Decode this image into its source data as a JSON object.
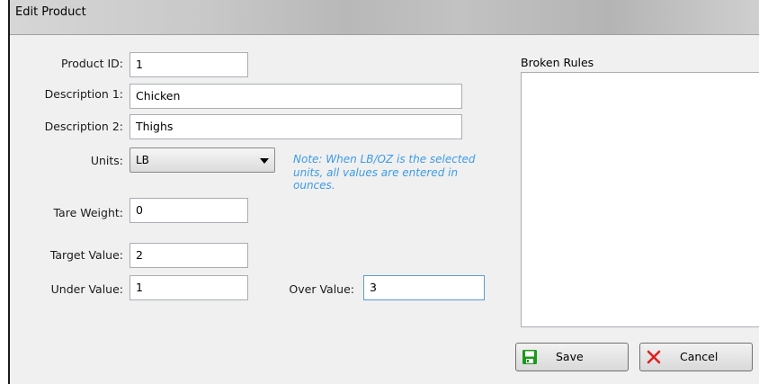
{
  "window": {
    "title": "Edit Product"
  },
  "form": {
    "product_id": {
      "label": "Product ID:",
      "value": "1"
    },
    "description1": {
      "label": "Description 1:",
      "value": "Chicken"
    },
    "description2": {
      "label": "Description 2:",
      "value": "Thighs"
    },
    "units": {
      "label": "Units:",
      "selected": "LB"
    },
    "note": "Note: When LB/OZ is the selected units, all values are entered in ounces.",
    "tare_weight": {
      "label": "Tare Weight:",
      "value": "0"
    },
    "target_value": {
      "label": "Target Value:",
      "value": "2"
    },
    "under_value": {
      "label": "Under Value:",
      "value": "1"
    },
    "over_value": {
      "label": "Over Value:",
      "value": "3"
    }
  },
  "broken_rules": {
    "label": "Broken Rules"
  },
  "buttons": {
    "save": {
      "label": "Save",
      "icon": "save-icon"
    },
    "cancel": {
      "label": "Cancel",
      "icon": "cancel-icon"
    }
  },
  "colors": {
    "note": "#3c9be6",
    "save_icon": "#1a9a1a",
    "cancel_icon": "#e02020"
  }
}
